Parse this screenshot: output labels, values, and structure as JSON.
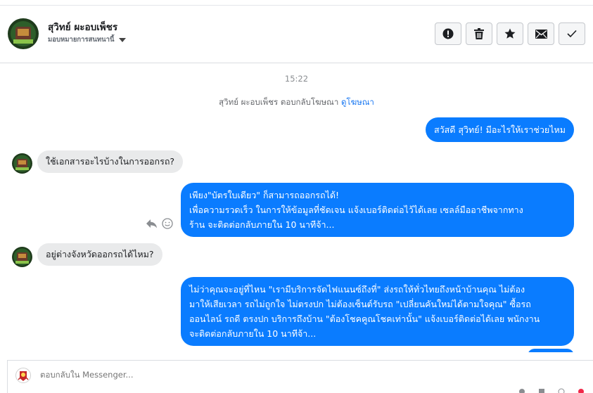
{
  "contact": {
    "name": "สุวิทย์ ผะอบเพ็ชร",
    "assigned_label": "มอบหมายการสนทนานี้"
  },
  "actions": [
    {
      "name": "mark-spam-button",
      "icon": "alert-icon"
    },
    {
      "name": "delete-button",
      "icon": "trash-icon"
    },
    {
      "name": "star-button",
      "icon": "star-icon"
    },
    {
      "name": "mark-unread-button",
      "icon": "envelope-icon"
    },
    {
      "name": "mark-done-button",
      "icon": "check-icon"
    }
  ],
  "thread": {
    "timestamp": "15:22",
    "replied_note": "สุวิทย์ ผะอบเพ็ชร ตอบกลับโฆษณา",
    "replied_link": "ดูโฆษณา",
    "messages": [
      {
        "direction": "out",
        "text": "สวัสดี สุวิทย์! มีอะไรให้เราช่วยไหม"
      },
      {
        "direction": "in",
        "text": "ใช้เอกสารอะไรบ้างในการออกรถ?"
      },
      {
        "direction": "out",
        "lines": [
          "เพียง\"บัตรใบเดียว\" ก็สามารถออกรถได้!",
          "เพื่อความรวดเร็ว ในการให้ข้อมูลที่ชัดเจน แจ้งเบอร์ติดต่อไว้ได้เลย เซลล์มืออาชีพจากทาง",
          "ร้าน จะติดต่อกลับภายใน 10 นาทีจ้า..."
        ]
      },
      {
        "direction": "in",
        "text": "อยู่ต่างจังหวัดออกรถได้ไหม?"
      },
      {
        "direction": "out",
        "lines": [
          "ไม่ว่าคุณจะอยู่ที่ไหน \"เรามีบริการจัดไฟแนนซ์ถึงที่\"  ส่งรถให้ทั่วไทยถึงหน้าบ้านคุณ ไม่ต้อง",
          "มาให้เสียเวลา รถไม่ถูกใจ ไม่ตรงปก ไม่ต้องเซ็นต์รับรถ \"เปลี่ยนคันใหม่ได้ตามใจคุณ\" ซื้อรถ",
          "ออนไลน์ รถดี ตรงปก บริการถึงบ้าน \"ต้องโชคคูณโชคเท่านั้น\" แจ้งเบอร์ติดต่อได้เลย พนักงาน",
          "จะติดต่อกลับภายใน 10 นาทีจ้า..."
        ]
      }
    ]
  },
  "composer": {
    "placeholder": "ตอบกลับใน Messenger..."
  },
  "colors": {
    "outgoing_bubble": "#0a7cff",
    "incoming_bubble": "#e9eaeb",
    "link": "#1877f2"
  }
}
